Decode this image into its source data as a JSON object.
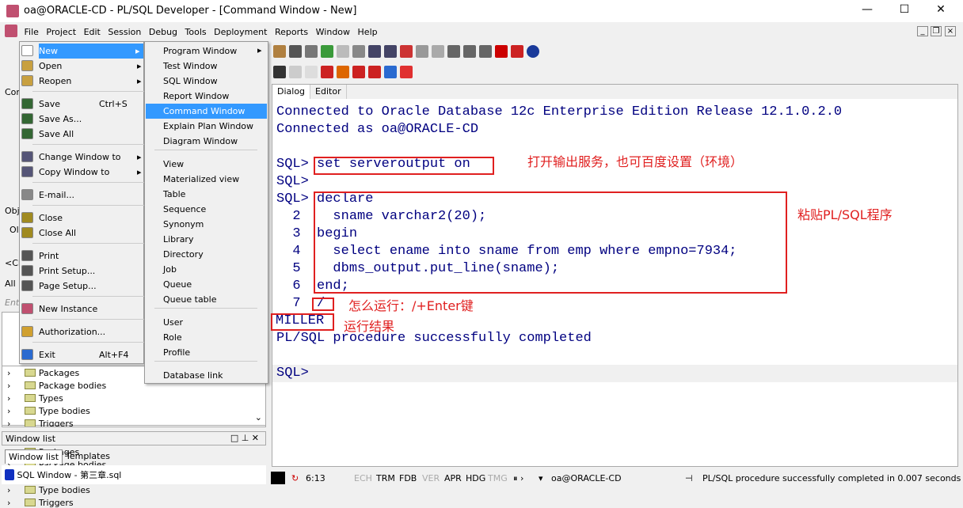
{
  "title": "oa@ORACLE-CD - PL/SQL Developer - [Command Window - New]",
  "window_controls": [
    "minimize",
    "maximize",
    "close"
  ],
  "menubar": [
    "File",
    "Project",
    "Edit",
    "Session",
    "Debug",
    "Tools",
    "Deployment",
    "Reports",
    "Window",
    "Help"
  ],
  "file_menu": [
    {
      "label": "New",
      "shortcut": ""
    },
    {
      "label": "Open",
      "shortcut": ""
    },
    {
      "label": "Reopen",
      "shortcut": ""
    },
    {
      "label": "Save",
      "shortcut": "Ctrl+S"
    },
    {
      "label": "Save As...",
      "shortcut": ""
    },
    {
      "label": "Save All",
      "shortcut": ""
    },
    {
      "label": "Change Window to",
      "shortcut": ""
    },
    {
      "label": "Copy Window to",
      "shortcut": ""
    },
    {
      "label": "E-mail...",
      "shortcut": ""
    },
    {
      "label": "Close",
      "shortcut": ""
    },
    {
      "label": "Close All",
      "shortcut": ""
    },
    {
      "label": "Print",
      "shortcut": ""
    },
    {
      "label": "Print Setup...",
      "shortcut": ""
    },
    {
      "label": "Page Setup...",
      "shortcut": ""
    },
    {
      "label": "New Instance",
      "shortcut": ""
    },
    {
      "label": "Authorization...",
      "shortcut": ""
    },
    {
      "label": "Exit",
      "shortcut": "Alt+F4"
    }
  ],
  "new_submenu": [
    "Program Window",
    "Test Window",
    "SQL Window",
    "Report Window",
    "Command Window",
    "Explain Plan Window",
    "Diagram Window",
    "View",
    "Materialized view",
    "Table",
    "Sequence",
    "Synonym",
    "Library",
    "Directory",
    "Job",
    "Queue",
    "Queue table",
    "User",
    "Role",
    "Profile",
    "Database link"
  ],
  "left_panel": {
    "partial": [
      "Cor",
      "Obj",
      "Ol",
      "<Cl",
      "All",
      "Ent"
    ],
    "tree": [
      "Packages",
      "Package bodies",
      "Types",
      "Type bodies",
      "Triggers"
    ],
    "window_list_title": "Window list",
    "tabs": [
      "Window list",
      "Templates"
    ],
    "window_item": "SQL Window - 第三章.sql"
  },
  "editor": {
    "tabs": [
      "Dialog",
      "Editor"
    ],
    "lines": [
      "Connected to Oracle Database 12c Enterprise Edition Release 12.1.0.2.0",
      "Connected as oa@ORACLE-CD",
      "",
      "SQL> set serveroutput on",
      "SQL> ",
      "SQL> declare",
      "  2    sname varchar2(20);",
      "  3  begin",
      "  4    select ename into sname from emp where empno=7934;",
      "  5    dbms_output.put_line(sname);",
      "  6  end;",
      "  7  /",
      "MILLER",
      "PL/SQL procedure successfully completed",
      "",
      "SQL> "
    ],
    "annotations": [
      "打开输出服务，也可百度设置（环境）",
      "粘贴PL/SQL程序",
      "怎么运行：/+Enter键",
      "运行结果"
    ]
  },
  "status": {
    "line": "6:13",
    "flags": [
      "ECH",
      "TRM",
      "FDB",
      "VER",
      "APR",
      "HDG",
      "TMG"
    ],
    "connection": "oa@ORACLE-CD",
    "message": "PL/SQL procedure successfully completed in 0.007 seconds"
  },
  "colors": {
    "accent": "#3399ff",
    "annotation": "#e02020",
    "code": "#000080"
  }
}
